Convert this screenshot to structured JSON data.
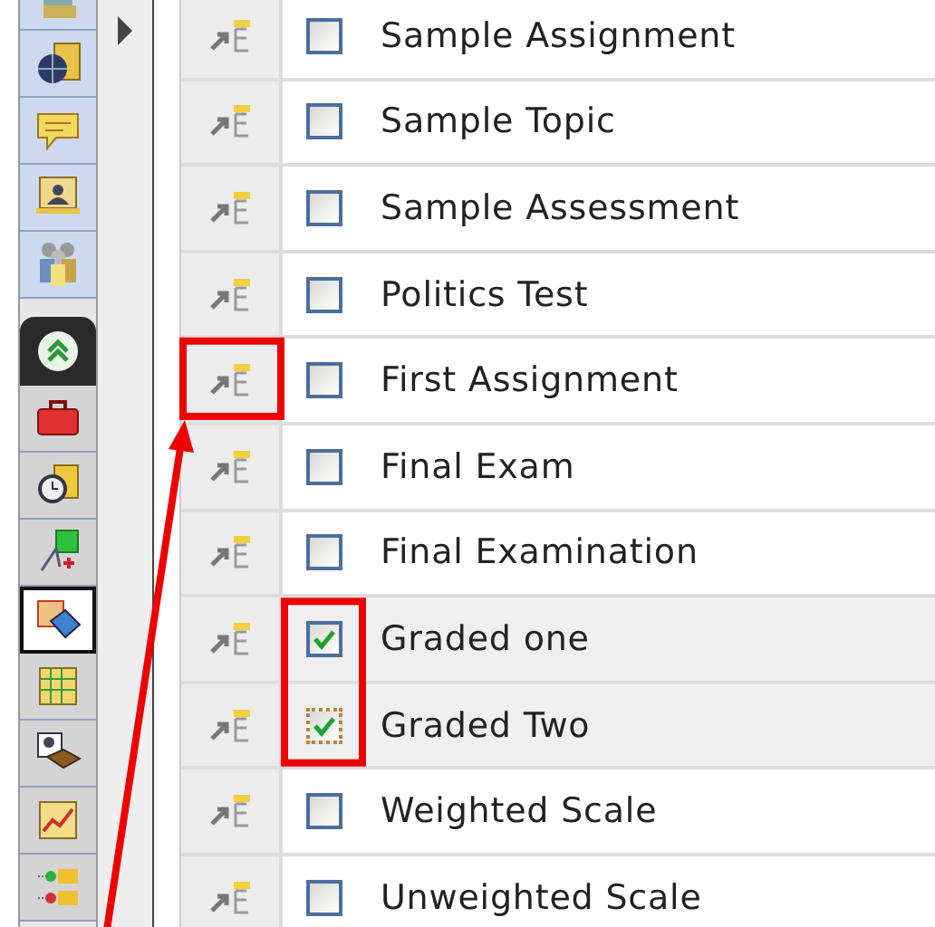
{
  "sidebar": {
    "top_tools": [
      {
        "kind": "gear",
        "selected": false
      },
      {
        "kind": "globe",
        "selected": false
      },
      {
        "kind": "bubble",
        "selected": false
      },
      {
        "kind": "portrait",
        "selected": false
      },
      {
        "kind": "people",
        "selected": false
      }
    ],
    "section": {
      "expanded": true,
      "tools": [
        {
          "kind": "toolbox",
          "selected": false
        },
        {
          "kind": "clock",
          "selected": false
        },
        {
          "kind": "network",
          "selected": false
        },
        {
          "kind": "shapes",
          "selected": true
        },
        {
          "kind": "grid",
          "selected": false
        },
        {
          "kind": "book",
          "selected": false
        },
        {
          "kind": "chart",
          "selected": false
        },
        {
          "kind": "connector",
          "selected": false
        }
      ]
    },
    "collapsed": false
  },
  "rows": [
    {
      "title": "Sample Assignment",
      "checked": false,
      "focused": false,
      "selected": false,
      "icon_marked": false,
      "check_marked": false
    },
    {
      "title": "Sample Topic",
      "checked": false,
      "focused": false,
      "selected": false,
      "icon_marked": false,
      "check_marked": false
    },
    {
      "title": "Sample Assessment",
      "checked": false,
      "focused": false,
      "selected": false,
      "icon_marked": false,
      "check_marked": false
    },
    {
      "title": "Politics Test",
      "checked": false,
      "focused": false,
      "selected": false,
      "icon_marked": false,
      "check_marked": false
    },
    {
      "title": "First Assignment",
      "checked": false,
      "focused": false,
      "selected": false,
      "icon_marked": true,
      "check_marked": false
    },
    {
      "title": "Final Exam",
      "checked": false,
      "focused": false,
      "selected": false,
      "icon_marked": false,
      "check_marked": false
    },
    {
      "title": "Final Examination",
      "checked": false,
      "focused": false,
      "selected": false,
      "icon_marked": false,
      "check_marked": false
    },
    {
      "title": "Graded one",
      "checked": true,
      "focused": false,
      "selected": true,
      "icon_marked": false,
      "check_marked": true
    },
    {
      "title": "Graded Two",
      "checked": true,
      "focused": true,
      "selected": true,
      "icon_marked": false,
      "check_marked": true
    },
    {
      "title": "Weighted Scale",
      "checked": false,
      "focused": false,
      "selected": false,
      "icon_marked": false,
      "check_marked": false
    },
    {
      "title": "Unweighted Scale",
      "checked": false,
      "focused": false,
      "selected": false,
      "icon_marked": false,
      "check_marked": false
    }
  ]
}
